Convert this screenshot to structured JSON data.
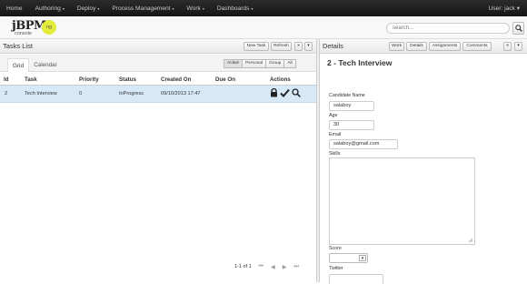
{
  "topnav": {
    "items": [
      {
        "label": "Home",
        "caret": ""
      },
      {
        "label": "Authoring",
        "caret": "▾"
      },
      {
        "label": "Deploy",
        "caret": "▾"
      },
      {
        "label": "Process Management",
        "caret": "▾"
      },
      {
        "label": "Work",
        "caret": "▾"
      },
      {
        "label": "Dashboards",
        "caret": "▾"
      }
    ],
    "user": "User: jack ▾"
  },
  "logo": {
    "title": "jBPM",
    "subtitle": "console",
    "badge": "ng"
  },
  "search": {
    "placeholder": "search..."
  },
  "tasks_panel": {
    "title": "Tasks List",
    "buttons": {
      "new_task": "New Task",
      "refresh": "Refresh",
      "close": "×",
      "menu": "▾"
    },
    "tabs": [
      "Grid",
      "Calendar"
    ],
    "filters": [
      "Active",
      "Personal",
      "Group",
      "All"
    ],
    "columns": [
      "Id",
      "Task",
      "Priority",
      "Status",
      "Created On",
      "Due On",
      "Actions"
    ],
    "rows": [
      {
        "id": "2",
        "task": "Tech Interview",
        "priority": "0",
        "status": "InProgress",
        "created_on": "09/10/2013 17:47",
        "due_on": ""
      }
    ],
    "pager": {
      "label": "1-1 of 1",
      "first": "⏮",
      "prev": "◀",
      "next": "▶",
      "last": "⏭"
    }
  },
  "details_panel": {
    "title": "Details",
    "buttons": {
      "work": "Work",
      "details": "Details",
      "assignments": "Assignments",
      "comments": "Comments",
      "close": "×",
      "menu": "▾"
    },
    "task_title": "2 - Tech Interview",
    "form": {
      "candidate_name_label": "Candidate Name",
      "candidate_name": "salaboy",
      "age_label": "Age",
      "age": "30",
      "email_label": "Email",
      "email": "salaboy@gmail.com",
      "skills_label": "Skills",
      "score_label": "Score",
      "twitter_label": "Twitter"
    }
  }
}
